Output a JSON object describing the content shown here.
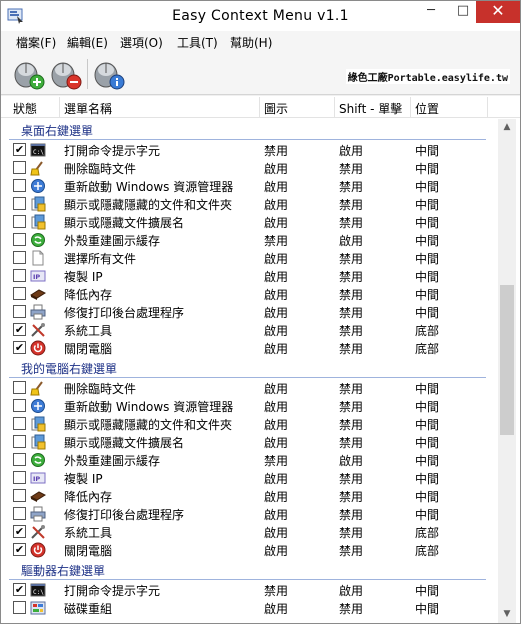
{
  "window": {
    "title": "Easy Context Menu v1.1",
    "min_glyph": "─",
    "max_glyph": "□",
    "close_glyph": "✕"
  },
  "menu": [
    "檔案(F)",
    "編輯(E)",
    "選項(O)",
    "工具(T)",
    "幫助(H)"
  ],
  "toolbar": {
    "brand_text": "綠色工廠Portable.easylife.tw"
  },
  "columns": {
    "state": "狀態",
    "name": "選單名稱",
    "left": "圖示",
    "shift": "Shift - 單擊",
    "pos": "位置"
  },
  "groups": [
    {
      "label": "桌面右鍵選單",
      "items": [
        {
          "checked": true,
          "icon": "cmd-icon",
          "name": "打開命令提示字元",
          "left": "禁用",
          "shift": "啟用",
          "pos": "中間"
        },
        {
          "checked": false,
          "icon": "broom-icon",
          "name": "刪除臨時文件",
          "left": "啟用",
          "shift": "禁用",
          "pos": "中間"
        },
        {
          "checked": false,
          "icon": "explorer-icon",
          "name": "重新啟動 Windows 資源管理器",
          "left": "啟用",
          "shift": "禁用",
          "pos": "中間"
        },
        {
          "checked": false,
          "icon": "files-icon",
          "name": "顯示或隱藏隱藏的文件和文件夾",
          "left": "啟用",
          "shift": "禁用",
          "pos": "中間"
        },
        {
          "checked": false,
          "icon": "files-icon",
          "name": "顯示或隱藏文件擴展名",
          "left": "啟用",
          "shift": "禁用",
          "pos": "中間"
        },
        {
          "checked": false,
          "icon": "refresh-icon",
          "name": "外殼重建圖示緩存",
          "left": "禁用",
          "shift": "啟用",
          "pos": "中間"
        },
        {
          "checked": false,
          "icon": "file-icon",
          "name": "選擇所有文件",
          "left": "啟用",
          "shift": "禁用",
          "pos": "中間"
        },
        {
          "checked": false,
          "icon": "ip-icon",
          "name": "複製 IP",
          "left": "啟用",
          "shift": "禁用",
          "pos": "中間"
        },
        {
          "checked": false,
          "icon": "memory-icon",
          "name": "降低內存",
          "left": "啟用",
          "shift": "禁用",
          "pos": "中間"
        },
        {
          "checked": false,
          "icon": "printer-icon",
          "name": "修復打印後台處理程序",
          "left": "啟用",
          "shift": "禁用",
          "pos": "中間"
        },
        {
          "checked": true,
          "icon": "tools-icon",
          "name": "系統工具",
          "left": "啟用",
          "shift": "禁用",
          "pos": "底部"
        },
        {
          "checked": true,
          "icon": "power-icon",
          "name": "關閉電腦",
          "left": "啟用",
          "shift": "禁用",
          "pos": "底部"
        }
      ]
    },
    {
      "label": "我的電腦右鍵選單",
      "items": [
        {
          "checked": false,
          "icon": "broom-icon",
          "name": "刪除臨時文件",
          "left": "啟用",
          "shift": "禁用",
          "pos": "中間"
        },
        {
          "checked": false,
          "icon": "explorer-icon",
          "name": "重新啟動 Windows 資源管理器",
          "left": "啟用",
          "shift": "禁用",
          "pos": "中間"
        },
        {
          "checked": false,
          "icon": "files-icon",
          "name": "顯示或隱藏隱藏的文件和文件夾",
          "left": "啟用",
          "shift": "禁用",
          "pos": "中間"
        },
        {
          "checked": false,
          "icon": "files-icon",
          "name": "顯示或隱藏文件擴展名",
          "left": "啟用",
          "shift": "禁用",
          "pos": "中間"
        },
        {
          "checked": false,
          "icon": "refresh-icon",
          "name": "外殼重建圖示緩存",
          "left": "禁用",
          "shift": "啟用",
          "pos": "中間"
        },
        {
          "checked": false,
          "icon": "ip-icon",
          "name": "複製 IP",
          "left": "啟用",
          "shift": "禁用",
          "pos": "中間"
        },
        {
          "checked": false,
          "icon": "memory-icon",
          "name": "降低內存",
          "left": "啟用",
          "shift": "禁用",
          "pos": "中間"
        },
        {
          "checked": false,
          "icon": "printer-icon",
          "name": "修復打印後台處理程序",
          "left": "啟用",
          "shift": "禁用",
          "pos": "中間"
        },
        {
          "checked": true,
          "icon": "tools-icon",
          "name": "系統工具",
          "left": "啟用",
          "shift": "禁用",
          "pos": "底部"
        },
        {
          "checked": true,
          "icon": "power-icon",
          "name": "關閉電腦",
          "left": "啟用",
          "shift": "禁用",
          "pos": "底部"
        }
      ]
    },
    {
      "label": "驅動器右鍵選單",
      "items": [
        {
          "checked": true,
          "icon": "cmd-icon",
          "name": "打開命令提示字元",
          "left": "禁用",
          "shift": "啟用",
          "pos": "中間"
        },
        {
          "checked": false,
          "icon": "defrag-icon",
          "name": "磁碟重組",
          "left": "啟用",
          "shift": "禁用",
          "pos": "中間"
        }
      ]
    }
  ]
}
